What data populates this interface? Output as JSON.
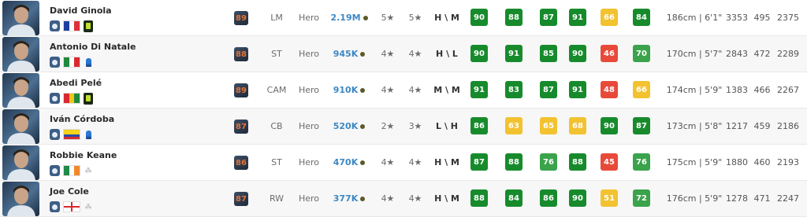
{
  "colors": {
    "stat_high": "#178b2c",
    "stat_good": "#3aa34b",
    "stat_mid": "#f2c230",
    "stat_low": "#e84a3a",
    "price": "#3c88c4",
    "rating": "#e0733a"
  },
  "players": [
    {
      "name": "David Ginola",
      "rating": "89",
      "position": "LM",
      "version": "Hero",
      "price": "2.19M",
      "skill_moves": "5★",
      "weak_foot": "5★",
      "work_rates": "H \\ M",
      "pace": "90",
      "shooting": "88",
      "passing": "87",
      "dribbling": "91",
      "defending": "66",
      "physical": "84",
      "height": "186cm | 6'1\"",
      "igs": "3353",
      "bs": "495",
      "total": "2375",
      "flag": "france",
      "league": "ligue1"
    },
    {
      "name": "Antonio Di Natale",
      "rating": "88",
      "position": "ST",
      "version": "Hero",
      "price": "945K",
      "skill_moves": "4★",
      "weak_foot": "4★",
      "work_rates": "H \\ L",
      "pace": "90",
      "shooting": "91",
      "passing": "85",
      "dribbling": "90",
      "defending": "46",
      "physical": "70",
      "height": "170cm | 5'7\"",
      "igs": "2843",
      "bs": "472",
      "total": "2289",
      "flag": "italy",
      "league": "seriea"
    },
    {
      "name": "Abedi Pelé",
      "rating": "89",
      "position": "CAM",
      "version": "Hero",
      "price": "910K",
      "skill_moves": "4★",
      "weak_foot": "4★",
      "work_rates": "M \\ M",
      "pace": "91",
      "shooting": "83",
      "passing": "87",
      "dribbling": "91",
      "defending": "48",
      "physical": "66",
      "height": "174cm | 5'9\"",
      "igs": "1383",
      "bs": "466",
      "total": "2267",
      "flag": "ghana",
      "league": "ligue1"
    },
    {
      "name": "Iván Córdoba",
      "rating": "87",
      "position": "CB",
      "version": "Hero",
      "price": "520K",
      "skill_moves": "2★",
      "weak_foot": "3★",
      "work_rates": "L \\ H",
      "pace": "86",
      "shooting": "63",
      "passing": "65",
      "dribbling": "68",
      "defending": "90",
      "physical": "87",
      "height": "173cm | 5'8\"",
      "igs": "1217",
      "bs": "459",
      "total": "2186",
      "flag": "colombia",
      "league": "seriea"
    },
    {
      "name": "Robbie Keane",
      "rating": "86",
      "position": "ST",
      "version": "Hero",
      "price": "470K",
      "skill_moves": "4★",
      "weak_foot": "4★",
      "work_rates": "H \\ M",
      "pace": "87",
      "shooting": "88",
      "passing": "76",
      "dribbling": "88",
      "defending": "45",
      "physical": "76",
      "height": "175cm | 5'9\"",
      "igs": "1880",
      "bs": "460",
      "total": "2193",
      "flag": "ireland",
      "league": "pl"
    },
    {
      "name": "Joe Cole",
      "rating": "87",
      "position": "RW",
      "version": "Hero",
      "price": "377K",
      "skill_moves": "4★",
      "weak_foot": "4★",
      "work_rates": "H \\ M",
      "pace": "88",
      "shooting": "84",
      "passing": "86",
      "dribbling": "90",
      "defending": "51",
      "physical": "72",
      "height": "176cm | 5'9\"",
      "igs": "1278",
      "bs": "471",
      "total": "2247",
      "flag": "england",
      "league": "pl"
    }
  ]
}
